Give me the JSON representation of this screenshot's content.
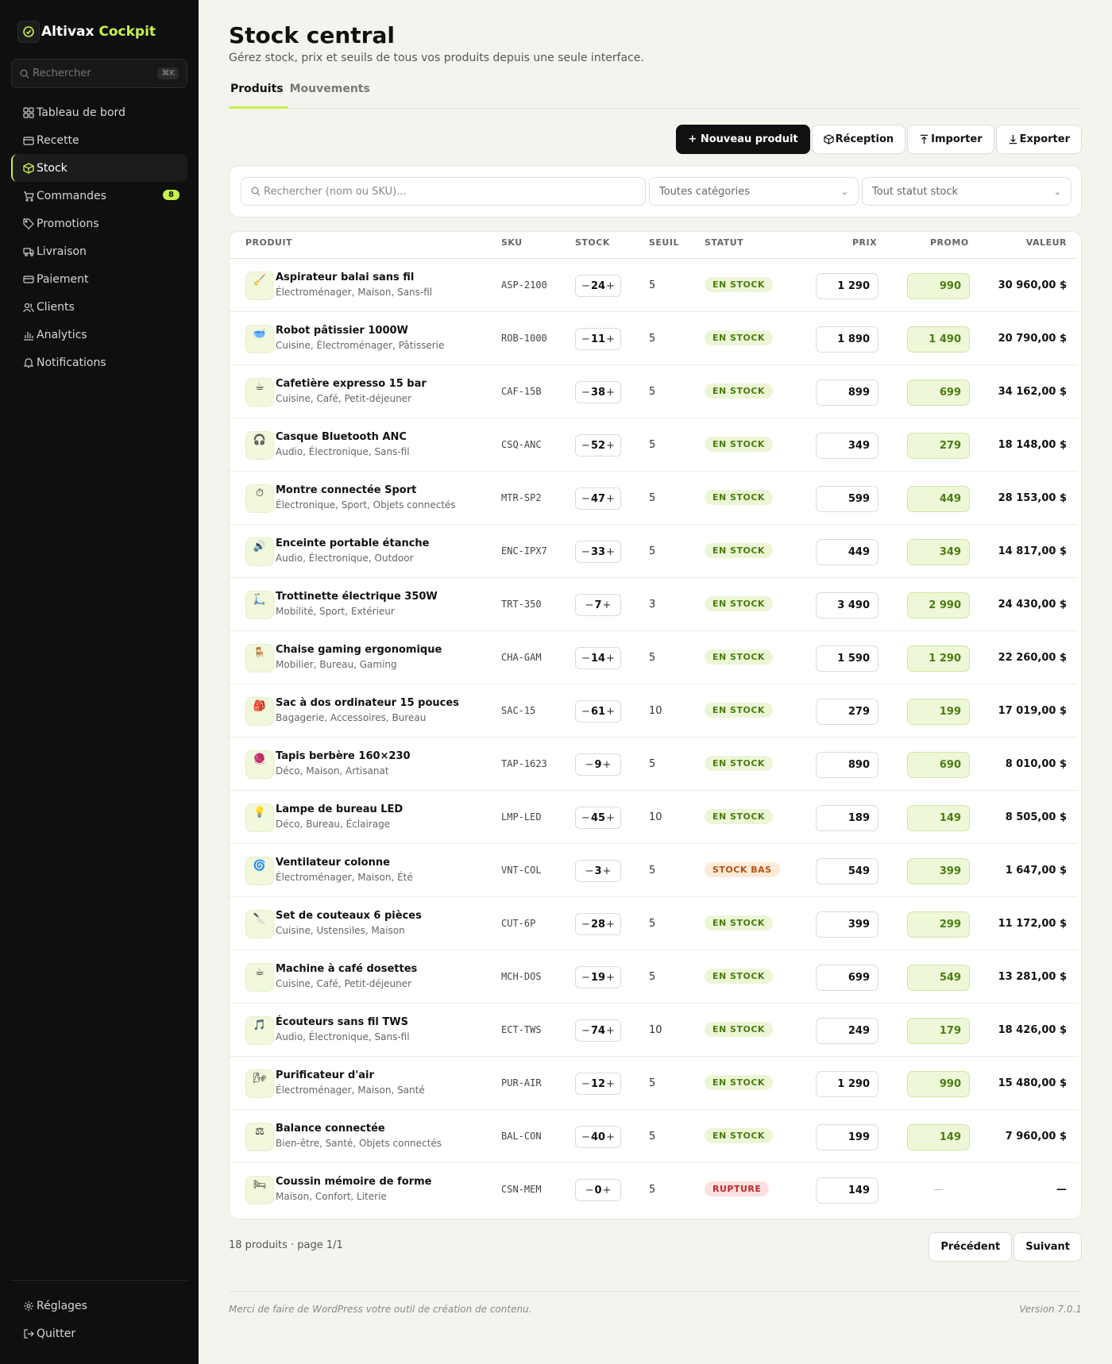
{
  "brand": {
    "name": "Altivax",
    "accent": "Cockpit",
    "accent_color": "#c6f24a"
  },
  "sidebar": {
    "search_placeholder": "Rechercher",
    "search_shortcut": "⌘K",
    "items": [
      {
        "label": "Tableau de bord",
        "icon": "grid-icon"
      },
      {
        "label": "Recette",
        "icon": "wallet-icon"
      },
      {
        "label": "Stock",
        "icon": "box-icon",
        "active": true
      },
      {
        "label": "Commandes",
        "icon": "cart-icon",
        "badge": "8"
      },
      {
        "label": "Promotions",
        "icon": "tag-icon"
      },
      {
        "label": "Livraison",
        "icon": "truck-icon"
      },
      {
        "label": "Paiement",
        "icon": "card-icon"
      },
      {
        "label": "Clients",
        "icon": "users-icon"
      },
      {
        "label": "Analytics",
        "icon": "chart-icon"
      },
      {
        "label": "Notifications",
        "icon": "bell-icon"
      }
    ],
    "bottom": [
      {
        "label": "Réglages",
        "icon": "gear-icon"
      },
      {
        "label": "Quitter",
        "icon": "logout-icon"
      }
    ]
  },
  "header": {
    "title": "Stock central",
    "subtitle": "Gérez stock, prix et seuils de tous vos produits depuis une seule interface."
  },
  "tabs": [
    {
      "label": "Produits",
      "active": true
    },
    {
      "label": "Mouvements",
      "active": false
    }
  ],
  "actions": {
    "new_product": "+ Nouveau produit",
    "reception": "Réception",
    "import": "Importer",
    "export": "Exporter"
  },
  "filters": {
    "search_placeholder": "Rechercher (nom ou SKU)...",
    "category": "Toutes catégories",
    "stock_status": "Tout statut stock"
  },
  "table": {
    "columns": [
      "PRODUIT",
      "SKU",
      "STOCK",
      "SEUIL",
      "STATUT",
      "PRIX",
      "PROMO",
      "VALEUR"
    ],
    "rows": [
      {
        "name": "Aspirateur balai sans fil",
        "categories": "Électroménager, Maison, Sans-fil",
        "sku": "ASP-2100",
        "stock": "24",
        "seuil": "5",
        "status": "EN STOCK",
        "status_type": "ok",
        "price": "1 290",
        "promo": "990",
        "value": "30 960,00 $",
        "icon": "🧹"
      },
      {
        "name": "Robot pâtissier 1000W",
        "categories": "Cuisine, Électroménager, Pâtisserie",
        "sku": "ROB-1000",
        "stock": "11",
        "seuil": "5",
        "status": "EN STOCK",
        "status_type": "ok",
        "price": "1 890",
        "promo": "1 490",
        "value": "20 790,00 $",
        "icon": "🥣"
      },
      {
        "name": "Cafetière expresso 15 bar",
        "categories": "Cuisine, Café, Petit-déjeuner",
        "sku": "CAF-15B",
        "stock": "38",
        "seuil": "5",
        "status": "EN STOCK",
        "status_type": "ok",
        "price": "899",
        "promo": "699",
        "value": "34 162,00 $",
        "icon": "☕"
      },
      {
        "name": "Casque Bluetooth ANC",
        "categories": "Audio, Électronique, Sans-fil",
        "sku": "CSQ-ANC",
        "stock": "52",
        "seuil": "5",
        "status": "EN STOCK",
        "status_type": "ok",
        "price": "349",
        "promo": "279",
        "value": "18 148,00 $",
        "icon": "🎧"
      },
      {
        "name": "Montre connectée Sport",
        "categories": "Électronique, Sport, Objets connectés",
        "sku": "MTR-SP2",
        "stock": "47",
        "seuil": "5",
        "status": "EN STOCK",
        "status_type": "ok",
        "price": "599",
        "promo": "449",
        "value": "28 153,00 $",
        "icon": "⏱"
      },
      {
        "name": "Enceinte portable étanche",
        "categories": "Audio, Électronique, Outdoor",
        "sku": "ENC-IPX7",
        "stock": "33",
        "seuil": "5",
        "status": "EN STOCK",
        "status_type": "ok",
        "price": "449",
        "promo": "349",
        "value": "14 817,00 $",
        "icon": "🔊"
      },
      {
        "name": "Trottinette électrique 350W",
        "categories": "Mobilité, Sport, Extérieur",
        "sku": "TRT-350",
        "stock": "7",
        "seuil": "3",
        "status": "EN STOCK",
        "status_type": "ok",
        "price": "3 490",
        "promo": "2 990",
        "value": "24 430,00 $",
        "icon": "🛴"
      },
      {
        "name": "Chaise gaming ergonomique",
        "categories": "Mobilier, Bureau, Gaming",
        "sku": "CHA-GAM",
        "stock": "14",
        "seuil": "5",
        "status": "EN STOCK",
        "status_type": "ok",
        "price": "1 590",
        "promo": "1 290",
        "value": "22 260,00 $",
        "icon": "🪑"
      },
      {
        "name": "Sac à dos ordinateur 15 pouces",
        "categories": "Bagagerie, Accessoires, Bureau",
        "sku": "SAC-15",
        "stock": "61",
        "seuil": "10",
        "status": "EN STOCK",
        "status_type": "ok",
        "price": "279",
        "promo": "199",
        "value": "17 019,00 $",
        "icon": "🎒"
      },
      {
        "name": "Tapis berbère 160×230",
        "categories": "Déco, Maison, Artisanat",
        "sku": "TAP-1623",
        "stock": "9",
        "seuil": "5",
        "status": "EN STOCK",
        "status_type": "ok",
        "price": "890",
        "promo": "690",
        "value": "8 010,00 $",
        "icon": "🧶"
      },
      {
        "name": "Lampe de bureau LED",
        "categories": "Déco, Bureau, Éclairage",
        "sku": "LMP-LED",
        "stock": "45",
        "seuil": "10",
        "status": "EN STOCK",
        "status_type": "ok",
        "price": "189",
        "promo": "149",
        "value": "8 505,00 $",
        "icon": "💡"
      },
      {
        "name": "Ventilateur colonne",
        "categories": "Électroménager, Maison, Été",
        "sku": "VNT-COL",
        "stock": "3",
        "seuil": "5",
        "status": "STOCK BAS",
        "status_type": "low",
        "price": "549",
        "promo": "399",
        "value": "1 647,00 $",
        "icon": "🌀"
      },
      {
        "name": "Set de couteaux 6 pièces",
        "categories": "Cuisine, Ustensiles, Maison",
        "sku": "CUT-6P",
        "stock": "28",
        "seuil": "5",
        "status": "EN STOCK",
        "status_type": "ok",
        "price": "399",
        "promo": "299",
        "value": "11 172,00 $",
        "icon": "🔪"
      },
      {
        "name": "Machine à café dosettes",
        "categories": "Cuisine, Café, Petit-déjeuner",
        "sku": "MCH-DOS",
        "stock": "19",
        "seuil": "5",
        "status": "EN STOCK",
        "status_type": "ok",
        "price": "699",
        "promo": "549",
        "value": "13 281,00 $",
        "icon": "☕"
      },
      {
        "name": "Écouteurs sans fil TWS",
        "categories": "Audio, Électronique, Sans-fil",
        "sku": "ECT-TWS",
        "stock": "74",
        "seuil": "10",
        "status": "EN STOCK",
        "status_type": "ok",
        "price": "249",
        "promo": "179",
        "value": "18 426,00 $",
        "icon": "🎵"
      },
      {
        "name": "Purificateur d'air",
        "categories": "Électroménager, Maison, Santé",
        "sku": "PUR-AIR",
        "stock": "12",
        "seuil": "5",
        "status": "EN STOCK",
        "status_type": "ok",
        "price": "1 290",
        "promo": "990",
        "value": "15 480,00 $",
        "icon": "🌬"
      },
      {
        "name": "Balance connectée",
        "categories": "Bien-être, Santé, Objets connectés",
        "sku": "BAL-CON",
        "stock": "40",
        "seuil": "5",
        "status": "EN STOCK",
        "status_type": "ok",
        "price": "199",
        "promo": "149",
        "value": "7 960,00 $",
        "icon": "⚖"
      },
      {
        "name": "Coussin mémoire de forme",
        "categories": "Maison, Confort, Literie",
        "sku": "CSN-MEM",
        "stock": "0",
        "seuil": "5",
        "status": "RUPTURE",
        "status_type": "out",
        "price": "149",
        "promo": "—",
        "value": "—",
        "icon": "🛏"
      }
    ]
  },
  "pagination": {
    "info": "18 produits · page 1/1",
    "prev": "Précédent",
    "next": "Suivant"
  },
  "footer": {
    "left": "Merci de faire de WordPress votre outil de création de contenu.",
    "right": "Version 7.0.1"
  }
}
